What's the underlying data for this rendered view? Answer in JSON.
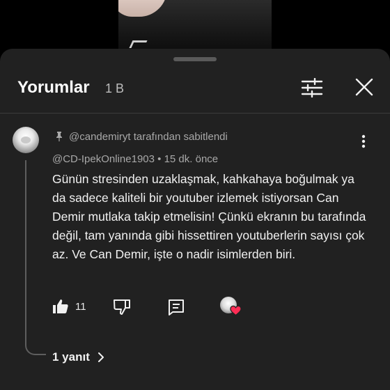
{
  "header": {
    "title": "Yorumlar",
    "count": "1 B"
  },
  "comment": {
    "pinned_label": "@candemiryt tarafından sabitlendi",
    "author": "@CD-IpekOnline1903",
    "separator": "•",
    "time": "15 dk. önce",
    "text": "Günün stresinden uzaklaşmak, kahkahaya boğulmak ya da sadece kaliteli bir youtuber izlemek istiyorsan Can Demir mutlaka takip etmelisin! Çünkü ekranın bu tarafında değil, tam yanında gibi hissettiren youtuberlerin sayısı çok az. Ve Can Demir, işte o nadir isimlerden biri.",
    "likes": "11",
    "replies_label": "1 yanıt"
  },
  "colors": {
    "sheet_bg": "#212121",
    "text_primary": "#f1f1f1",
    "text_secondary": "#a8a8a8",
    "heart": "#ff2d55"
  },
  "icons": {
    "filter": "sliders-icon",
    "close": "close-icon",
    "pin": "pin-icon",
    "more": "more-vertical-icon",
    "like": "thumbs-up-icon",
    "dislike": "thumbs-down-icon",
    "reply": "reply-icon",
    "creator_heart": "creator-heart-icon",
    "chevron": "chevron-right-icon"
  }
}
